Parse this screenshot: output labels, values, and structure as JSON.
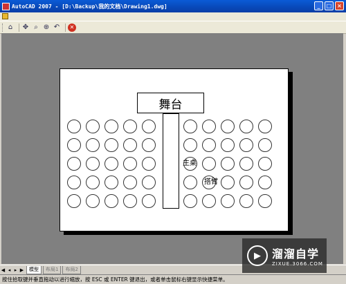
{
  "window": {
    "title": "AutoCAD 2007 - [D:\\Backup\\我的文档\\Drawing1.dwg]",
    "minimize": "_",
    "maximize": "□",
    "close": "×"
  },
  "drawing": {
    "stage_label": "舞台",
    "seat_labels": [
      "主桌",
      "搭臂"
    ]
  },
  "layout_tabs": [
    "模型",
    "布局1",
    "布局2"
  ],
  "status": {
    "text": "按住拾取键并垂直拖动以进行缩放，按 ESC 或 ENTER 键退出，或者单击鼠标右键显示快捷菜单。"
  },
  "watermark": {
    "brand": "溜溜自学",
    "url": "ZIXUE.3066.COM",
    "logo": "play-icon"
  },
  "colors": {
    "titlebar": "#0a5bd6",
    "workspace": "#808080",
    "paper": "#ffffff"
  }
}
